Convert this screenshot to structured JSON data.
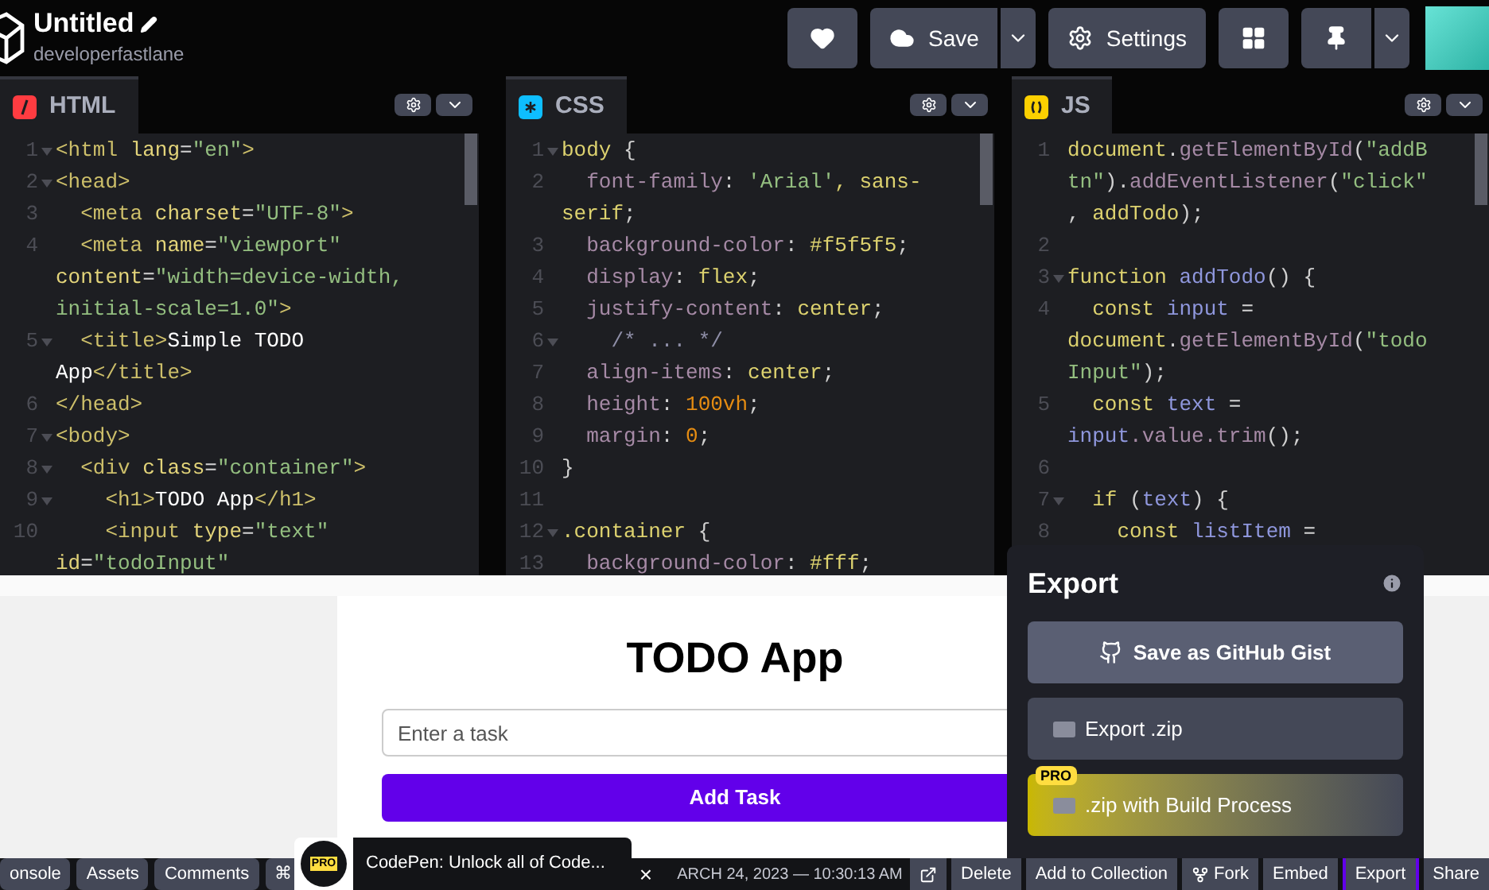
{
  "topbar": {
    "title": "Untitled",
    "user": "developerfastlane",
    "buttons": [
      {
        "kind": "heart",
        "caret": false
      },
      {
        "kind": "save",
        "label": "Save",
        "caret": true
      },
      {
        "kind": "settings",
        "label": "Settings",
        "caret": false
      },
      {
        "kind": "layout",
        "caret": false
      },
      {
        "kind": "pin",
        "caret": true
      }
    ]
  },
  "editors": [
    {
      "kind": "html",
      "lang": "HTML",
      "lines": [
        {
          "num": "1",
          "fold": true,
          "tokens": [
            {
              "text": "<html",
              "kind": "tag"
            },
            {
              "text": " lang",
              "kind": "attr"
            },
            {
              "text": "=",
              "kind": "punct"
            },
            {
              "text": "\"en\"",
              "kind": "string"
            },
            {
              "text": ">",
              "kind": "tag"
            }
          ]
        },
        {
          "num": "2",
          "fold": true,
          "tokens": [
            {
              "text": "<head>",
              "kind": "tag"
            }
          ]
        },
        {
          "num": "3",
          "fold": false,
          "tokens": [
            {
              "text": "  <meta",
              "kind": "tag"
            },
            {
              "text": " charset",
              "kind": "attr"
            },
            {
              "text": "=",
              "kind": "punct"
            },
            {
              "text": "\"UTF-8\"",
              "kind": "string"
            },
            {
              "text": ">",
              "kind": "tag"
            }
          ]
        },
        {
          "num": "4",
          "fold": false,
          "tokens": [
            {
              "text": "  <meta",
              "kind": "tag"
            },
            {
              "text": " name",
              "kind": "attr"
            },
            {
              "text": "=",
              "kind": "punct"
            },
            {
              "text": "\"viewport\"",
              "kind": "string"
            }
          ]
        },
        {
          "fold": false,
          "tokens": [
            {
              "text": "content",
              "kind": "attr"
            },
            {
              "text": "=",
              "kind": "punct"
            },
            {
              "text": "\"width=device-width,",
              "kind": "string"
            }
          ]
        },
        {
          "fold": false,
          "tokens": [
            {
              "text": "initial-scale=1.0\"",
              "kind": "string"
            },
            {
              "text": ">",
              "kind": "tag"
            }
          ]
        },
        {
          "num": "5",
          "fold": true,
          "tokens": [
            {
              "text": "  <title>",
              "kind": "tag"
            },
            {
              "text": "Simple TODO",
              "kind": "text"
            }
          ]
        },
        {
          "fold": false,
          "tokens": [
            {
              "text": "App",
              "kind": "text"
            },
            {
              "text": "</title>",
              "kind": "tag"
            }
          ]
        },
        {
          "num": "6",
          "fold": false,
          "tokens": [
            {
              "text": "</head>",
              "kind": "tag"
            }
          ]
        },
        {
          "num": "7",
          "fold": true,
          "tokens": [
            {
              "text": "<body>",
              "kind": "tag"
            }
          ]
        },
        {
          "num": "8",
          "fold": true,
          "tokens": [
            {
              "text": "  <div",
              "kind": "tag"
            },
            {
              "text": " class",
              "kind": "attr"
            },
            {
              "text": "=",
              "kind": "punct"
            },
            {
              "text": "\"container\"",
              "kind": "string"
            },
            {
              "text": ">",
              "kind": "tag"
            }
          ]
        },
        {
          "num": "9",
          "fold": true,
          "tokens": [
            {
              "text": "    <h1>",
              "kind": "tag"
            },
            {
              "text": "TODO App",
              "kind": "text"
            },
            {
              "text": "</h1>",
              "kind": "tag"
            }
          ]
        },
        {
          "num": "10",
          "fold": false,
          "tokens": [
            {
              "text": "    <input",
              "kind": "tag"
            },
            {
              "text": " type",
              "kind": "attr"
            },
            {
              "text": "=",
              "kind": "punct"
            },
            {
              "text": "\"text\"",
              "kind": "string"
            }
          ]
        },
        {
          "fold": false,
          "tokens": [
            {
              "text": "id",
              "kind": "attr"
            },
            {
              "text": "=",
              "kind": "punct"
            },
            {
              "text": "\"todoInput\"",
              "kind": "string"
            }
          ]
        }
      ]
    },
    {
      "kind": "css",
      "lang": "CSS",
      "lines": [
        {
          "num": "1",
          "fold": true,
          "tokens": [
            {
              "text": "body",
              "kind": "value"
            },
            {
              "text": " {",
              "kind": "punct"
            }
          ]
        },
        {
          "num": "2",
          "fold": false,
          "tokens": [
            {
              "text": "  font-family",
              "kind": "prop"
            },
            {
              "text": ": ",
              "kind": "punct"
            },
            {
              "text": "'Arial'",
              "kind": "string"
            },
            {
              "text": ", sans-",
              "kind": "value"
            }
          ]
        },
        {
          "fold": false,
          "tokens": [
            {
              "text": "serif",
              "kind": "value"
            },
            {
              "text": ";",
              "kind": "punct"
            }
          ]
        },
        {
          "num": "3",
          "fold": false,
          "tokens": [
            {
              "text": "  background-color",
              "kind": "prop"
            },
            {
              "text": ": ",
              "kind": "punct"
            },
            {
              "text": "#f5f5f5",
              "kind": "value"
            },
            {
              "text": ";",
              "kind": "punct"
            }
          ]
        },
        {
          "num": "4",
          "fold": false,
          "tokens": [
            {
              "text": "  display",
              "kind": "prop"
            },
            {
              "text": ": ",
              "kind": "punct"
            },
            {
              "text": "flex",
              "kind": "value"
            },
            {
              "text": ";",
              "kind": "punct"
            }
          ]
        },
        {
          "num": "5",
          "fold": false,
          "tokens": [
            {
              "text": "  justify-content",
              "kind": "prop"
            },
            {
              "text": ": ",
              "kind": "punct"
            },
            {
              "text": "center",
              "kind": "value"
            },
            {
              "text": ";",
              "kind": "punct"
            }
          ]
        },
        {
          "num": "6",
          "fold": true,
          "tokens": [
            {
              "text": "    /* ... */",
              "kind": "comment"
            }
          ]
        },
        {
          "num": "7",
          "fold": false,
          "tokens": [
            {
              "text": "  align-items",
              "kind": "prop"
            },
            {
              "text": ": ",
              "kind": "punct"
            },
            {
              "text": "center",
              "kind": "value"
            },
            {
              "text": ";",
              "kind": "punct"
            }
          ]
        },
        {
          "num": "8",
          "fold": false,
          "tokens": [
            {
              "text": "  height",
              "kind": "prop"
            },
            {
              "text": ": ",
              "kind": "punct"
            },
            {
              "text": "100vh",
              "kind": "number"
            },
            {
              "text": ";",
              "kind": "punct"
            }
          ]
        },
        {
          "num": "9",
          "fold": false,
          "tokens": [
            {
              "text": "  margin",
              "kind": "prop"
            },
            {
              "text": ": ",
              "kind": "punct"
            },
            {
              "text": "0",
              "kind": "number"
            },
            {
              "text": ";",
              "kind": "punct"
            }
          ]
        },
        {
          "num": "10",
          "fold": false,
          "tokens": [
            {
              "text": "}",
              "kind": "punct"
            }
          ]
        },
        {
          "num": "11",
          "fold": false
        },
        {
          "num": "12",
          "fold": true,
          "tokens": [
            {
              "text": ".container",
              "kind": "value"
            },
            {
              "text": " {",
              "kind": "punct"
            }
          ]
        },
        {
          "num": "13",
          "fold": false,
          "tokens": [
            {
              "text": "  background-color",
              "kind": "prop"
            },
            {
              "text": ": ",
              "kind": "punct"
            },
            {
              "text": "#fff",
              "kind": "value"
            },
            {
              "text": ";",
              "kind": "punct"
            }
          ]
        }
      ]
    },
    {
      "kind": "js",
      "lang": "JS",
      "lines": [
        {
          "num": "1",
          "fold": false,
          "tokens": [
            {
              "text": "document",
              "kind": "value"
            },
            {
              "text": ".",
              "kind": "punct"
            },
            {
              "text": "getElementById",
              "kind": "fn"
            },
            {
              "text": "(",
              "kind": "punct"
            },
            {
              "text": "\"addB",
              "kind": "string"
            }
          ]
        },
        {
          "fold": false,
          "tokens": [
            {
              "text": "tn\"",
              "kind": "string"
            },
            {
              "text": ").",
              "kind": "punct"
            },
            {
              "text": "addEventListener",
              "kind": "fn"
            },
            {
              "text": "(",
              "kind": "punct"
            },
            {
              "text": "\"click\"",
              "kind": "string"
            }
          ]
        },
        {
          "fold": false,
          "tokens": [
            {
              "text": ", ",
              "kind": "punct"
            },
            {
              "text": "addTodo",
              "kind": "value"
            },
            {
              "text": ");",
              "kind": "punct"
            }
          ]
        },
        {
          "num": "2",
          "fold": false
        },
        {
          "num": "3",
          "fold": true,
          "tokens": [
            {
              "text": "function",
              "kind": "value"
            },
            {
              "text": " addTodo",
              "kind": "var"
            },
            {
              "text": "() {",
              "kind": "punct"
            }
          ]
        },
        {
          "num": "4",
          "fold": false,
          "tokens": [
            {
              "text": "  const",
              "kind": "value"
            },
            {
              "text": " input",
              "kind": "var"
            },
            {
              "text": " =",
              "kind": "punct"
            }
          ]
        },
        {
          "fold": false,
          "tokens": [
            {
              "text": "document",
              "kind": "value"
            },
            {
              "text": ".",
              "kind": "punct"
            },
            {
              "text": "getElementById",
              "kind": "fn"
            },
            {
              "text": "(",
              "kind": "punct"
            },
            {
              "text": "\"todo",
              "kind": "string"
            }
          ]
        },
        {
          "fold": false,
          "tokens": [
            {
              "text": "Input\"",
              "kind": "string"
            },
            {
              "text": ");",
              "kind": "punct"
            }
          ]
        },
        {
          "num": "5",
          "fold": false,
          "tokens": [
            {
              "text": "  const",
              "kind": "value"
            },
            {
              "text": " text",
              "kind": "var"
            },
            {
              "text": " =",
              "kind": "punct"
            }
          ]
        },
        {
          "fold": false,
          "tokens": [
            {
              "text": "input",
              "kind": "var"
            },
            {
              "text": ".value.trim",
              "kind": "fn"
            },
            {
              "text": "();",
              "kind": "punct"
            }
          ]
        },
        {
          "num": "6",
          "fold": false
        },
        {
          "num": "7",
          "fold": true,
          "tokens": [
            {
              "text": "  if",
              "kind": "value"
            },
            {
              "text": " (",
              "kind": "punct"
            },
            {
              "text": "text",
              "kind": "var"
            },
            {
              "text": ") {",
              "kind": "punct"
            }
          ]
        },
        {
          "num": "8",
          "fold": false,
          "tokens": [
            {
              "text": "    const",
              "kind": "value"
            },
            {
              "text": " listItem",
              "kind": "var"
            },
            {
              "text": " =",
              "kind": "punct"
            }
          ]
        }
      ]
    }
  ],
  "preview": {
    "heading": "TODO App",
    "input_placeholder": "Enter a task",
    "button": "Add Task"
  },
  "export_menu": {
    "title": "Export",
    "options": [
      {
        "kind": "gist",
        "label": "Save as GitHub Gist"
      },
      {
        "kind": "zip",
        "label": "Export .zip"
      },
      {
        "kind": "build",
        "label": ".zip with Build Process",
        "badge": "PRO"
      }
    ]
  },
  "bottom_bar": {
    "left": [
      "onsole",
      "Assets",
      "Comments",
      "⌘"
    ],
    "toast": {
      "badge": "PRO",
      "text": "CodePen: Unlock all of Code...",
      "close": "×"
    },
    "date": "ARCH 24, 2023 — 10:30:13 AM",
    "right": [
      {
        "kind": "external",
        "selected": false
      },
      {
        "kind": "text",
        "label": "Delete",
        "selected": false
      },
      {
        "kind": "text",
        "label": "Add to Collection",
        "selected": false
      },
      {
        "kind": "fork",
        "label": "Fork",
        "selected": false
      },
      {
        "kind": "text",
        "label": "Embed",
        "selected": false
      },
      {
        "kind": "text",
        "label": "Export",
        "selected": true
      },
      {
        "kind": "text",
        "label": "Share",
        "selected": false
      }
    ]
  }
}
